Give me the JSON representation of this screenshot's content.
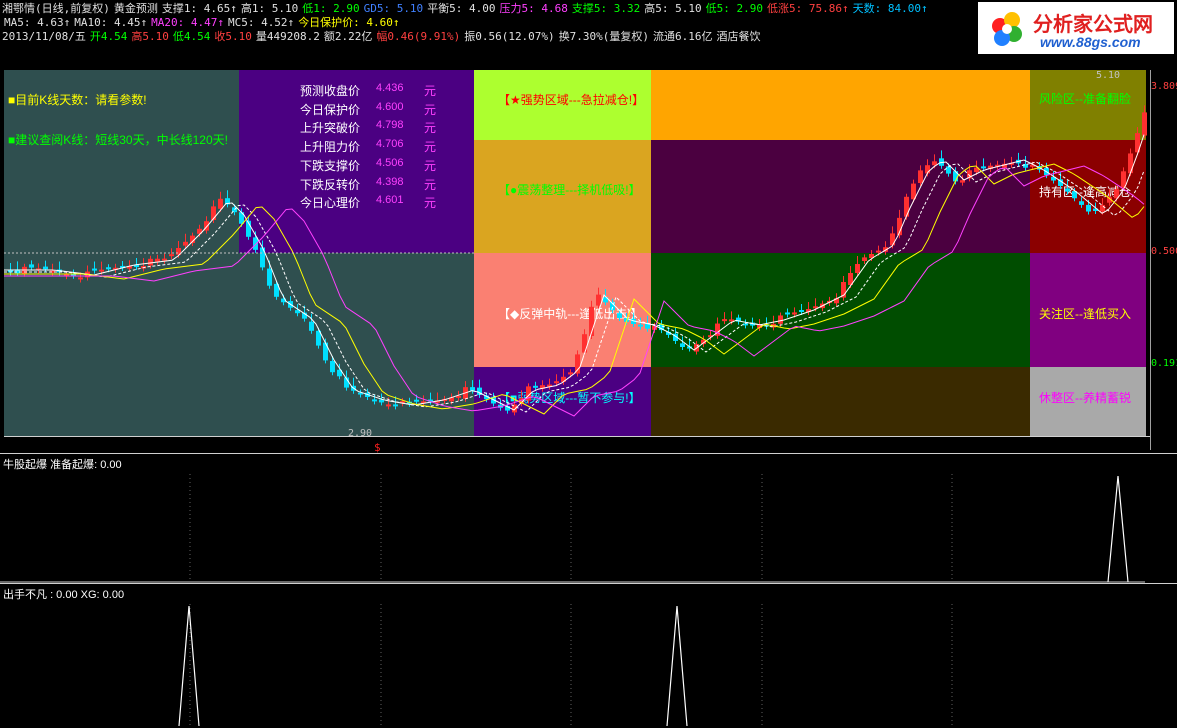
{
  "header": {
    "row1": [
      {
        "t": "湘鄂情(日线,前复权)",
        "c": "w"
      },
      {
        "t": "黄金预测",
        "c": "w"
      },
      {
        "t": "支撑1: 4.65↑",
        "c": "w"
      },
      {
        "t": "高1: 5.10",
        "c": "w"
      },
      {
        "t": "低1: 2.90",
        "c": "g"
      },
      {
        "t": "GD5: 5.10",
        "c": "b"
      },
      {
        "t": "平衡5: 4.00",
        "c": "w"
      },
      {
        "t": "压力5: 4.68",
        "c": "m"
      },
      {
        "t": "支撑5: 3.32",
        "c": "g"
      },
      {
        "t": "高5: 5.10",
        "c": "w"
      },
      {
        "t": "低5: 2.90",
        "c": "g"
      },
      {
        "t": "低涨5: 75.86↑",
        "c": "r"
      },
      {
        "t": "天数: 84.00↑",
        "c": "c"
      }
    ],
    "row2": [
      {
        "t": "MA5: 4.63↑",
        "c": "w"
      },
      {
        "t": "MA10: 4.45↑",
        "c": "w"
      },
      {
        "t": "MA20: 4.47↑",
        "c": "m"
      },
      {
        "t": "MC5: 4.52↑",
        "c": "w"
      },
      {
        "t": "今日保护价: 4.60↑",
        "c": "y"
      }
    ],
    "row3": [
      {
        "t": "2013/11/08/五",
        "c": "w"
      },
      {
        "t": "开4.54",
        "c": "g"
      },
      {
        "t": "高5.10",
        "c": "r"
      },
      {
        "t": "低4.54",
        "c": "g"
      },
      {
        "t": "收5.10",
        "c": "r"
      },
      {
        "t": "量449208.2",
        "c": "w"
      },
      {
        "t": "额2.22亿",
        "c": "w"
      },
      {
        "t": "幅0.46(9.91%)",
        "c": "r"
      },
      {
        "t": "振0.56(12.07%)",
        "c": "w"
      },
      {
        "t": "换7.30%(量复权)",
        "c": "w"
      },
      {
        "t": "流通6.16亿",
        "c": "w"
      },
      {
        "t": "酒店餐饮",
        "c": "w"
      }
    ]
  },
  "logo": {
    "title": "分析家公式网",
    "url": "www.88gs.com"
  },
  "notes": {
    "days": "■目前K线天数：请看参数!",
    "advice": "■建议查阅K线：短线30天，中长线120天!"
  },
  "prediction": {
    "unit": "元",
    "rows": [
      {
        "label": "预测收盘价",
        "value": "4.436"
      },
      {
        "label": "今日保护价",
        "value": "4.600"
      },
      {
        "label": "上升突破价",
        "value": "4.798"
      },
      {
        "label": "上升阻力价",
        "value": "4.706"
      },
      {
        "label": "下跌支撑价",
        "value": "4.506"
      },
      {
        "label": "下跌反转价",
        "value": "4.398"
      },
      {
        "label": "今日心理价",
        "value": "4.601"
      }
    ]
  },
  "zones_mid": {
    "strong": "【★强势区域---急拉减仓!】",
    "consol": "【●震荡整理---择机低吸!】",
    "rebound": "【◆反弹中轨---逢低出击!】",
    "weak": "【■弱势区域---暂不参与!】"
  },
  "zones_right": {
    "risk": "风险区--准备翻脸",
    "hold": "持有区--逢高减仓",
    "watch": "关注区--逢低买入",
    "rest": "休整区--养精蓄锐"
  },
  "price_axis": {
    "top": "3.809",
    "mid": "0.500",
    "low": "0.191",
    "high_mark": "5.10",
    "low_mark": "2.90"
  },
  "sub1": {
    "label": "牛股起爆",
    "name2": "准备起爆",
    "value": "0.00"
  },
  "sub2": {
    "label": "出手不凡",
    "value": ": 0.00",
    "name2": "XG:",
    "value2": "0.00"
  },
  "colors": {
    "bull": "#ff3030",
    "bear": "#00e0ff",
    "ma5": "#ffffff",
    "ma10": "#ffff00",
    "ma20": "#ff40ff",
    "mc5": "#ffffff"
  }
}
